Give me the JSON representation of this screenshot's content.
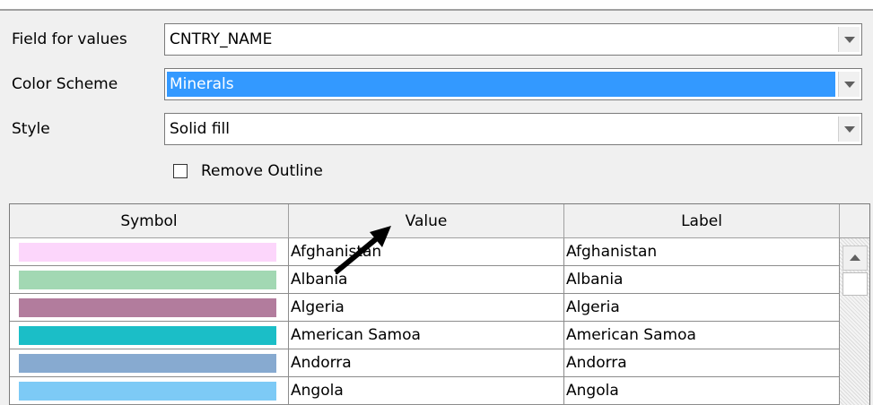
{
  "form": {
    "field_for_values": {
      "label": "Field for values",
      "value": "CNTRY_NAME"
    },
    "color_scheme": {
      "label": "Color Scheme",
      "value": "Minerals"
    },
    "style": {
      "label": "Style",
      "value": "Solid fill"
    },
    "remove_outline": {
      "label": "Remove Outline",
      "checked": false
    }
  },
  "table": {
    "columns": [
      "Symbol",
      "Value",
      "Label"
    ],
    "rows": [
      {
        "color": "#fcd6fb",
        "value": "Afghanistan",
        "label": "Afghanistan"
      },
      {
        "color": "#a2d8b3",
        "value": "Albania",
        "label": "Albania"
      },
      {
        "color": "#b27c9d",
        "value": "Algeria",
        "label": "Algeria"
      },
      {
        "color": "#1bbec7",
        "value": "American Samoa",
        "label": "American Samoa"
      },
      {
        "color": "#87aad0",
        "value": "Andorra",
        "label": "Andorra"
      },
      {
        "color": "#7dcaf6",
        "value": "Angola",
        "label": "Angola"
      }
    ]
  },
  "icons": {
    "dropdown": "chevron-down-icon",
    "scroll_up": "triangle-up-icon",
    "annotation": "arrow-pointer-icon"
  }
}
